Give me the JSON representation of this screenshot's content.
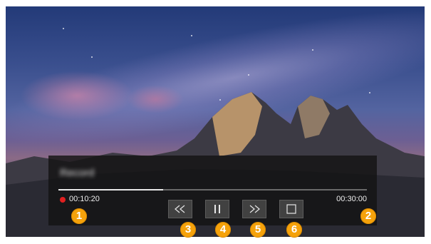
{
  "player": {
    "title": "Record",
    "current_time": "00:10:20",
    "duration": "00:30:00",
    "progress": 0.34,
    "recording": true
  },
  "controls": [
    {
      "name": "rewind-button",
      "icon": "rewind-icon"
    },
    {
      "name": "pause-button",
      "icon": "pause-icon"
    },
    {
      "name": "fast-forward-button",
      "icon": "fast-forward-icon"
    },
    {
      "name": "stop-button",
      "icon": "stop-icon"
    }
  ],
  "callouts": [
    "1",
    "2",
    "3",
    "4",
    "5",
    "6"
  ],
  "colors": {
    "panel_bg": "#141414",
    "record_dot": "#e02020",
    "callout": "#f5a20b"
  }
}
